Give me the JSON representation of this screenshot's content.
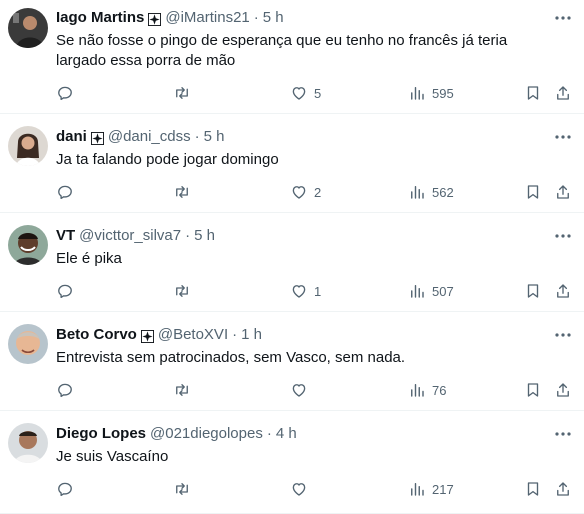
{
  "tweets": [
    {
      "name": "Iago Martins",
      "handle": "@iMartins21",
      "time": "5 h",
      "text": "Se não fosse o pingo de esperança que eu tenho no francês já teria largado essa porra de mão",
      "replies": "",
      "retweets": "",
      "likes": "5",
      "views": "595"
    },
    {
      "name": "dani",
      "handle": "@dani_cdss",
      "time": "5 h",
      "text": "Ja ta falando pode jogar domingo",
      "replies": "",
      "retweets": "",
      "likes": "2",
      "views": "562"
    },
    {
      "name": "VT",
      "handle": "@victtor_silva7",
      "time": "5 h",
      "text": "Ele é pika",
      "replies": "",
      "retweets": "",
      "likes": "1",
      "views": "507"
    },
    {
      "name": "Beto Corvo",
      "handle": "@BetoXVI",
      "time": "1 h",
      "text": "Entrevista sem patrocinados, sem Vasco, sem nada.",
      "replies": "",
      "retweets": "",
      "likes": "",
      "views": "76"
    },
    {
      "name": "Diego Lopes",
      "handle": "@021diegolopes",
      "time": "4 h",
      "text": "Je suis Vascaíno",
      "replies": "",
      "retweets": "",
      "likes": "",
      "views": "217"
    }
  ],
  "colors": {
    "text": "#0f1419",
    "secondary": "#536471",
    "divider": "#eff3f4"
  },
  "icons": [
    "cross-badge-icon",
    "more-icon",
    "reply-icon",
    "retweet-icon",
    "like-icon",
    "views-icon",
    "bookmark-icon",
    "share-icon"
  ]
}
